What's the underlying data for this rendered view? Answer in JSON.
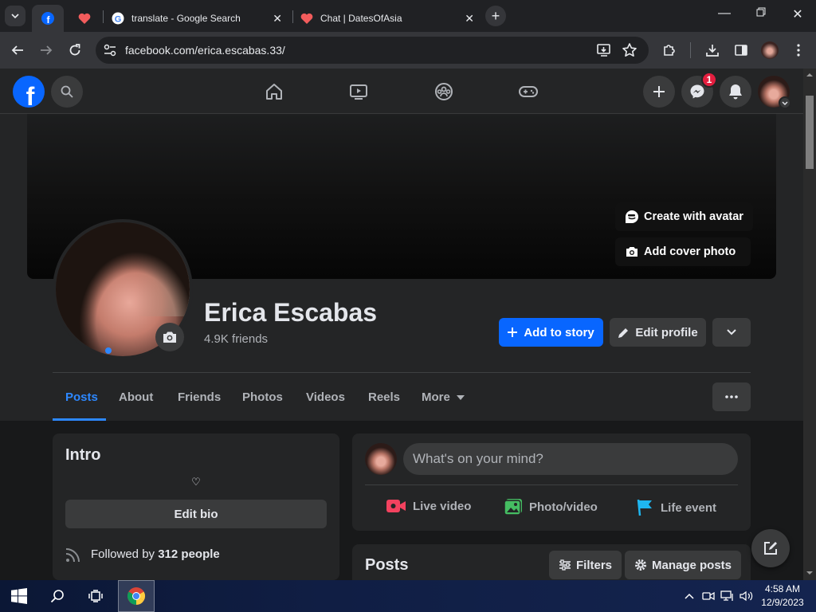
{
  "browser": {
    "tabs": [
      {
        "title": "",
        "icon": "facebook-icon",
        "active": true
      },
      {
        "title": "",
        "icon": "heart-icon"
      },
      {
        "title": "translate - Google Search",
        "icon": "google-icon"
      },
      {
        "title": "Chat | DatesOfAsia",
        "icon": "heart-icon"
      }
    ],
    "url": "facebook.com/erica.escabas.33/"
  },
  "fb_header": {
    "logo": "f",
    "messenger_badge": "1"
  },
  "cover": {
    "create_avatar_label": "Create with avatar",
    "add_cover_label": "Add cover photo"
  },
  "profile": {
    "name": "Erica Escabas",
    "friends": "4.9K friends",
    "add_story_label": "Add to story",
    "edit_profile_label": "Edit profile"
  },
  "profile_tabs": [
    {
      "label": "Posts",
      "active": true
    },
    {
      "label": "About"
    },
    {
      "label": "Friends"
    },
    {
      "label": "Photos"
    },
    {
      "label": "Videos"
    },
    {
      "label": "Reels"
    },
    {
      "label": "More"
    }
  ],
  "intro": {
    "title": "Intro",
    "bio": "♡",
    "edit_bio_label": "Edit bio",
    "followed_prefix": "Followed by ",
    "followed_count": "312 people"
  },
  "composer": {
    "placeholder": "What's on your mind?",
    "live_video_label": "Live video",
    "photo_video_label": "Photo/video",
    "life_event_label": "Life event"
  },
  "posts_section": {
    "title": "Posts",
    "filters_label": "Filters",
    "manage_label": "Manage posts"
  },
  "taskbar": {
    "time": "4:58 AM",
    "date": "12/9/2023"
  },
  "colors": {
    "fb_blue": "#0866ff",
    "bg": "#18191a",
    "surface": "#242526",
    "badge_red": "#e41e3f"
  }
}
